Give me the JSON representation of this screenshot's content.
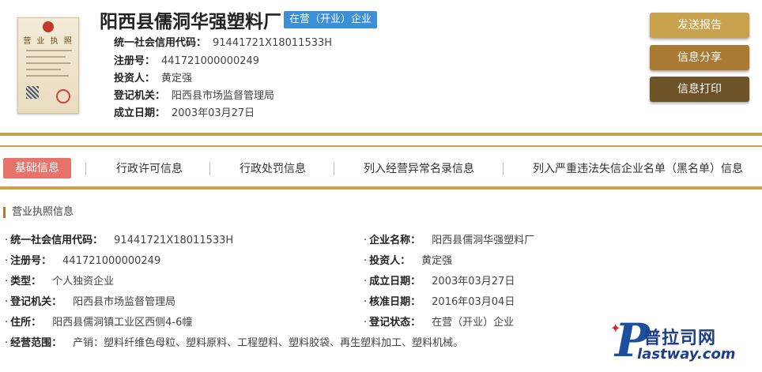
{
  "header": {
    "license_thumb_title": "营 业 执 照",
    "company_name": "阳西县儒洞华强塑料厂",
    "status_badge": "在营（开业）企业",
    "info": [
      {
        "label": "统一社会信用代码：",
        "value": "91441721X18011533H"
      },
      {
        "label": "注册号：",
        "value": "441721000000249"
      },
      {
        "label": "投资人：",
        "value": "黄定强"
      },
      {
        "label": "登记机关：",
        "value": "阳西县市场监督管理局"
      },
      {
        "label": "成立日期：",
        "value": "2003年03月27日"
      }
    ],
    "buttons": {
      "send": "发送报告",
      "share": "信息分享",
      "print": "信息打印"
    }
  },
  "tabs": [
    {
      "label": "基础信息",
      "active": true
    },
    {
      "label": "行政许可信息",
      "active": false
    },
    {
      "label": "行政处罚信息",
      "active": false
    },
    {
      "label": "列入经营异常名录信息",
      "active": false
    },
    {
      "label": "列入严重违法失信企业名单（黑名单）信息",
      "active": false
    }
  ],
  "section": {
    "title": "营业执照信息",
    "left": [
      {
        "label": "统一社会信用代码：",
        "value": "91441721X18011533H"
      },
      {
        "label": "注册号：",
        "value": "441721000000249"
      },
      {
        "label": "类型：",
        "value": "个人独资企业"
      },
      {
        "label": "登记机关：",
        "value": "阳西县市场监督管理局"
      },
      {
        "label": "住所：",
        "value": "阳西县儒洞镇工业区西侧4-6幢"
      }
    ],
    "right": [
      {
        "label": "企业名称：",
        "value": "阳西县儒洞华强塑料厂"
      },
      {
        "label": "投资人：",
        "value": "黄定强"
      },
      {
        "label": "成立日期：",
        "value": "2003年03月27日"
      },
      {
        "label": "核准日期：",
        "value": "2016年03月04日"
      },
      {
        "label": "登记状态：",
        "value": "在营（开业）企业"
      }
    ],
    "scope": {
      "label": "经营范围：",
      "value": "产销：塑料纤维色母粒、塑料原料、工程塑料、塑料胶袋、再生塑料加工、塑料机械。"
    }
  },
  "watermark": {
    "letter": "P",
    "cn": "普拉司网",
    "en": "lastway.com"
  },
  "colors": {
    "gold": "#c9a24e",
    "badge": "#3b8fd6",
    "active_tab": "#e8736b"
  }
}
